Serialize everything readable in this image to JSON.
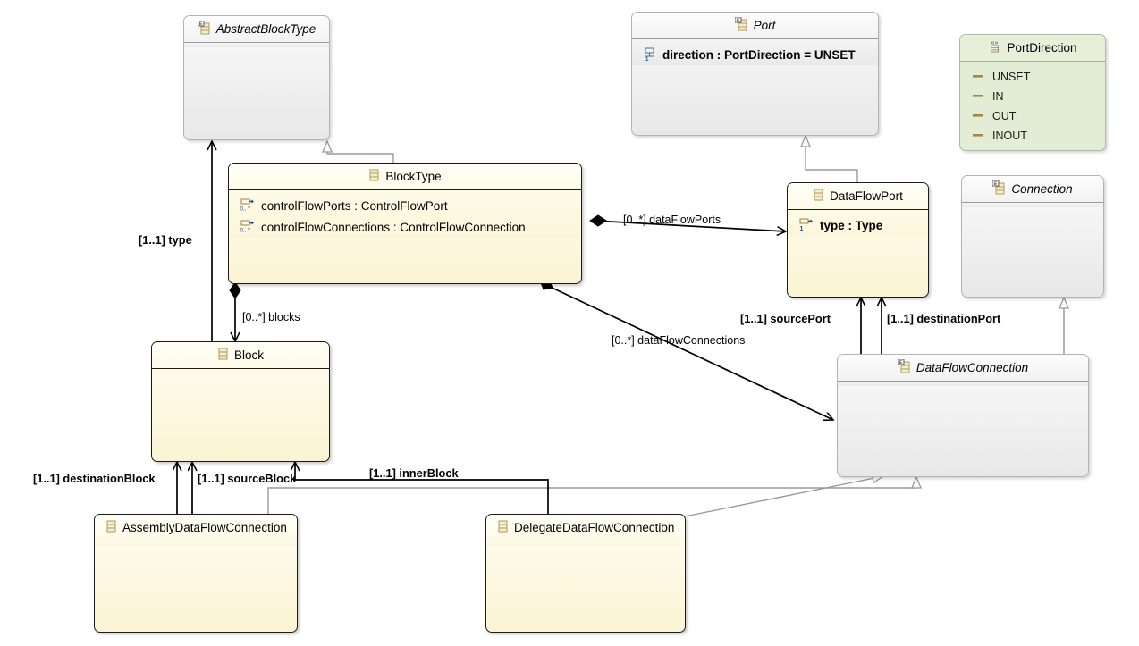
{
  "diagram": {
    "kind": "uml-class-diagram",
    "colors": {
      "concrete_fill": "#fdf8e0",
      "concrete_border": "#1a1a1a",
      "abstract_fill": "#eeeeee",
      "abstract_border": "#b3b3b3",
      "enum_fill": "#e3ecd5",
      "enum_border": "#b0b8a6",
      "edge": "#000000",
      "generalization_edge": "#9a9a9a"
    }
  },
  "classes": [
    {
      "id": "abstractBlockType",
      "name": "AbstractBlockType",
      "stereotype": "abstract",
      "icon": "eclass-abstract-icon",
      "attributes": []
    },
    {
      "id": "port",
      "name": "Port",
      "stereotype": "abstract",
      "icon": "eclass-abstract-icon",
      "attributes": [
        {
          "text": "direction : PortDirection = UNSET",
          "icon": "eattribute-icon",
          "multiplicity": "1"
        }
      ]
    },
    {
      "id": "blockType",
      "name": "BlockType",
      "stereotype": "concrete",
      "icon": "eclass-icon",
      "attributes": [
        {
          "text": "controlFlowPorts : ControlFlowPort",
          "icon": "ereference-icon",
          "multiplicity": "0..*"
        },
        {
          "text": "controlFlowConnections : ControlFlowConnection",
          "icon": "ereference-icon",
          "multiplicity": "0..*"
        }
      ]
    },
    {
      "id": "dataFlowPort",
      "name": "DataFlowPort",
      "stereotype": "concrete",
      "icon": "eclass-icon",
      "attributes": [
        {
          "text": "type : Type",
          "icon": "ereference-icon",
          "multiplicity": "1"
        }
      ]
    },
    {
      "id": "connection",
      "name": "Connection",
      "stereotype": "abstract",
      "icon": "eclass-abstract-icon",
      "attributes": []
    },
    {
      "id": "block",
      "name": "Block",
      "stereotype": "concrete",
      "icon": "eclass-icon",
      "attributes": []
    },
    {
      "id": "dataFlowConnection",
      "name": "DataFlowConnection",
      "stereotype": "abstract",
      "icon": "eclass-abstract-icon",
      "attributes": []
    },
    {
      "id": "assemblyDataFlowConnection",
      "name": "AssemblyDataFlowConnection",
      "stereotype": "concrete",
      "icon": "eclass-icon",
      "attributes": []
    },
    {
      "id": "delegateDataFlowConnection",
      "name": "DelegateDataFlowConnection",
      "stereotype": "concrete",
      "icon": "eclass-icon",
      "attributes": []
    }
  ],
  "enumerations": [
    {
      "id": "portDirection",
      "name": "PortDirection",
      "icon": "eenum-icon",
      "literals": [
        "UNSET",
        "IN",
        "OUT",
        "INOUT"
      ]
    }
  ],
  "edge_labels": [
    {
      "id": "type",
      "text": "[1..1] type",
      "bold": true
    },
    {
      "id": "blocks",
      "text": "[0..*] blocks",
      "bold": false
    },
    {
      "id": "dataFlowPorts",
      "text": "[0..*] dataFlowPorts",
      "bold": false
    },
    {
      "id": "dataFlowConnections",
      "text": "[0..*] dataFlowConnections",
      "bold": false
    },
    {
      "id": "sourcePort",
      "text": "[1..1] sourcePort",
      "bold": true
    },
    {
      "id": "destinationPort",
      "text": "[1..1] destinationPort",
      "bold": true
    },
    {
      "id": "destinationBlock",
      "text": "[1..1] destinationBlock",
      "bold": true
    },
    {
      "id": "sourceBlock",
      "text": "[1..1] sourceBlock",
      "bold": true
    },
    {
      "id": "innerBlock",
      "text": "[1..1] innerBlock",
      "bold": true
    }
  ],
  "relationships": [
    {
      "from": "blockType",
      "to": "abstractBlockType",
      "type": "generalization"
    },
    {
      "from": "block",
      "to": "abstractBlockType",
      "type": "association",
      "label": "type"
    },
    {
      "from": "blockType",
      "to": "block",
      "type": "composition",
      "label": "blocks"
    },
    {
      "from": "blockType",
      "to": "dataFlowPort",
      "type": "composition",
      "label": "dataFlowPorts"
    },
    {
      "from": "blockType",
      "to": "dataFlowConnection",
      "type": "composition",
      "label": "dataFlowConnections"
    },
    {
      "from": "dataFlowPort",
      "to": "port",
      "type": "generalization"
    },
    {
      "from": "dataFlowConnection",
      "to": "connection",
      "type": "generalization"
    },
    {
      "from": "dataFlowConnection",
      "to": "dataFlowPort",
      "type": "association",
      "label": "sourcePort"
    },
    {
      "from": "dataFlowConnection",
      "to": "dataFlowPort",
      "type": "association",
      "label": "destinationPort"
    },
    {
      "from": "assemblyDataFlowConnection",
      "to": "dataFlowConnection",
      "type": "generalization"
    },
    {
      "from": "delegateDataFlowConnection",
      "to": "dataFlowConnection",
      "type": "generalization"
    },
    {
      "from": "assemblyDataFlowConnection",
      "to": "block",
      "type": "association",
      "label": "destinationBlock"
    },
    {
      "from": "assemblyDataFlowConnection",
      "to": "block",
      "type": "association",
      "label": "sourceBlock"
    },
    {
      "from": "delegateDataFlowConnection",
      "to": "block",
      "type": "association",
      "label": "innerBlock"
    }
  ]
}
